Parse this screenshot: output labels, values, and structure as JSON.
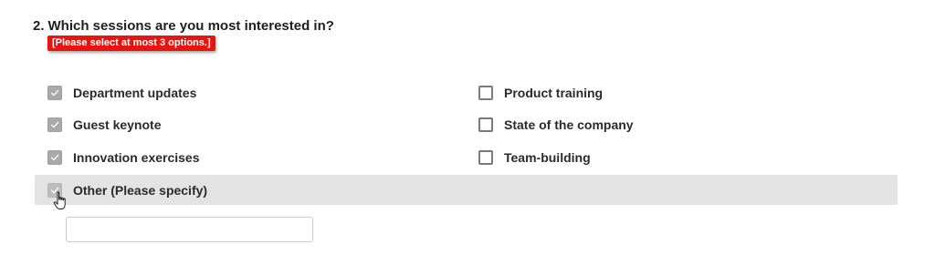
{
  "question": {
    "number": "2.",
    "text": "Which sessions are you most interested in?",
    "validation_message": "[Please select at most 3 options.]"
  },
  "options": [
    {
      "label": "Department updates",
      "checked": true
    },
    {
      "label": "Guest keynote",
      "checked": true
    },
    {
      "label": "Innovation exercises",
      "checked": true
    },
    {
      "label": "Product training",
      "checked": false
    },
    {
      "label": "State of the company",
      "checked": false
    },
    {
      "label": "Team-building",
      "checked": false
    },
    {
      "label": "Other (Please specify)",
      "checked": true
    }
  ],
  "other_input": {
    "value": "",
    "placeholder": ""
  },
  "icons": {
    "checkbox_checked": "checkmark-icon",
    "cursor": "hand-pointer-cursor-icon"
  },
  "colors": {
    "error_badge": "#e8140f",
    "checked_box": "#a9a9a9",
    "hover_row": "#e3e3e3"
  }
}
